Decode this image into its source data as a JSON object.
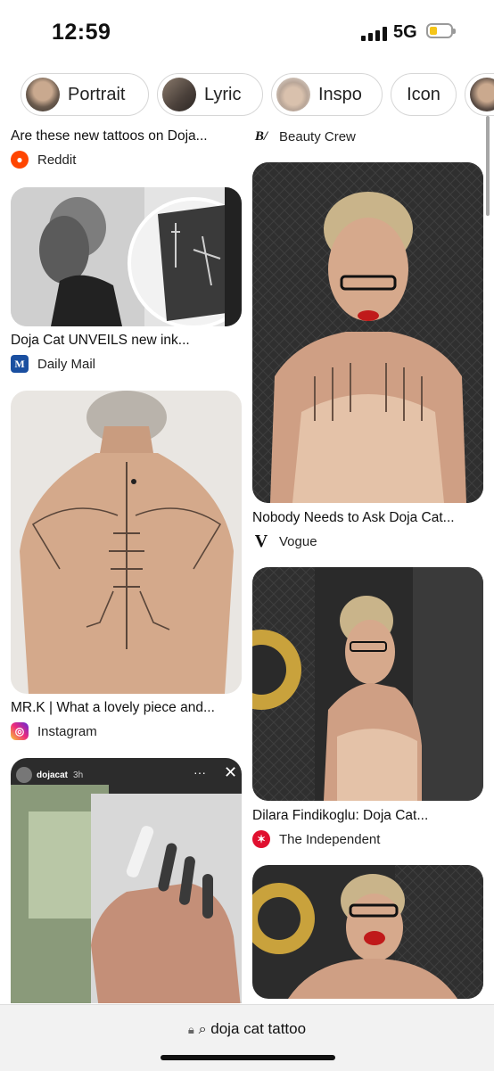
{
  "status": {
    "time": "12:59",
    "network": "5G"
  },
  "chips": [
    {
      "label": "Portrait"
    },
    {
      "label": "Lyric"
    },
    {
      "label": "Inspo"
    },
    {
      "label": "Icon"
    },
    {
      "label": ""
    }
  ],
  "left": {
    "card0": {
      "title": "Are these new tattoos on Doja...",
      "source": "Reddit"
    },
    "card1": {
      "title": "Doja Cat UNVEILS new ink...",
      "source": "Daily Mail"
    },
    "card2": {
      "title": "MR.K | What a lovely piece and...",
      "source": "Instagram"
    },
    "card3": {
      "story_user": "dojacat",
      "story_time": "3h"
    }
  },
  "right": {
    "card0": {
      "source": "Beauty Crew"
    },
    "card1": {
      "title": "Nobody Needs to Ask Doja Cat...",
      "source": "Vogue"
    },
    "card2": {
      "title": "Dilara Findikoglu: Doja Cat...",
      "source": "The Independent"
    }
  },
  "bottom": {
    "url": "doja cat tattoo"
  },
  "colors": {
    "reddit": "#ff4500",
    "dailymail": "#1a4fa0",
    "vogue": "#111111",
    "independent": "#e0102f"
  }
}
